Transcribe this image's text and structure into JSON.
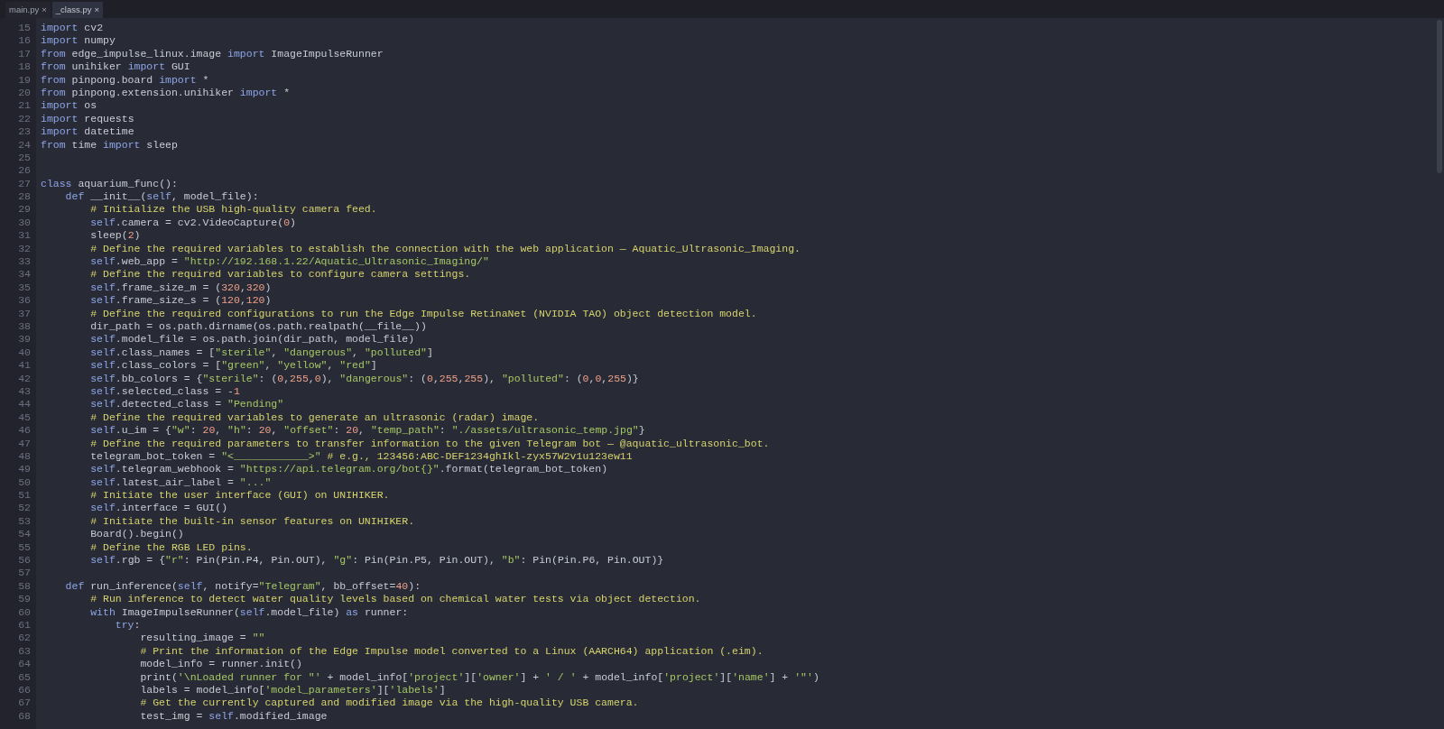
{
  "tabs": [
    {
      "label": "main.py",
      "close": "×",
      "selected": false
    },
    {
      "label": "_class.py",
      "close": "×",
      "selected": true
    }
  ],
  "editor": {
    "lines": [
      {
        "number": "15",
        "tokens": [
          {
            "kind": "kw",
            "text": "import"
          },
          {
            "kind": "plain",
            "text": " cv2"
          }
        ]
      },
      {
        "number": "16",
        "tokens": [
          {
            "kind": "kw",
            "text": "import"
          },
          {
            "kind": "plain",
            "text": " numpy"
          }
        ]
      },
      {
        "number": "17",
        "tokens": [
          {
            "kind": "kw",
            "text": "from"
          },
          {
            "kind": "plain",
            "text": " edge_impulse_linux.image "
          },
          {
            "kind": "kw",
            "text": "import"
          },
          {
            "kind": "plain",
            "text": " ImageImpulseRunner"
          }
        ]
      },
      {
        "number": "18",
        "tokens": [
          {
            "kind": "kw",
            "text": "from"
          },
          {
            "kind": "plain",
            "text": " unihiker "
          },
          {
            "kind": "kw",
            "text": "import"
          },
          {
            "kind": "plain",
            "text": " GUI"
          }
        ]
      },
      {
        "number": "19",
        "tokens": [
          {
            "kind": "kw",
            "text": "from"
          },
          {
            "kind": "plain",
            "text": " pinpong.board "
          },
          {
            "kind": "kw",
            "text": "import"
          },
          {
            "kind": "plain",
            "text": " *"
          }
        ]
      },
      {
        "number": "20",
        "tokens": [
          {
            "kind": "kw",
            "text": "from"
          },
          {
            "kind": "plain",
            "text": " pinpong.extension.unihiker "
          },
          {
            "kind": "kw",
            "text": "import"
          },
          {
            "kind": "plain",
            "text": " *"
          }
        ]
      },
      {
        "number": "21",
        "tokens": [
          {
            "kind": "kw",
            "text": "import"
          },
          {
            "kind": "plain",
            "text": " os"
          }
        ]
      },
      {
        "number": "22",
        "tokens": [
          {
            "kind": "kw",
            "text": "import"
          },
          {
            "kind": "plain",
            "text": " requests"
          }
        ]
      },
      {
        "number": "23",
        "tokens": [
          {
            "kind": "kw",
            "text": "import"
          },
          {
            "kind": "plain",
            "text": " datetime"
          }
        ]
      },
      {
        "number": "24",
        "tokens": [
          {
            "kind": "kw",
            "text": "from"
          },
          {
            "kind": "plain",
            "text": " time "
          },
          {
            "kind": "kw",
            "text": "import"
          },
          {
            "kind": "plain",
            "text": " sleep"
          }
        ]
      },
      {
        "number": "25"
      },
      {
        "number": "26"
      },
      {
        "number": "27",
        "tokens": [
          {
            "kind": "kw",
            "text": "class"
          },
          {
            "kind": "plain",
            "text": " aquarium_func():"
          }
        ]
      },
      {
        "number": "28",
        "tokens": [
          {
            "kind": "kw",
            "text": "    def"
          },
          {
            "kind": "plain",
            "text": " __init__("
          },
          {
            "kind": "kw",
            "text": "self"
          },
          {
            "kind": "plain",
            "text": ", model_file):"
          }
        ]
      },
      {
        "number": "29",
        "tokens": [
          {
            "kind": "com",
            "text": "        # Initialize the USB high-quality camera feed."
          }
        ]
      },
      {
        "number": "30",
        "tokens": [
          {
            "kind": "kw",
            "text": "        self"
          },
          {
            "kind": "plain",
            "text": ".camera = cv2.VideoCapture("
          },
          {
            "kind": "num",
            "text": "0"
          },
          {
            "kind": "plain",
            "text": ")"
          }
        ]
      },
      {
        "number": "31",
        "tokens": [
          {
            "kind": "plain",
            "text": "        sleep("
          },
          {
            "kind": "num",
            "text": "2"
          },
          {
            "kind": "plain",
            "text": ")"
          }
        ]
      },
      {
        "number": "32",
        "tokens": [
          {
            "kind": "com",
            "text": "        # Define the required variables to establish the connection with the web application — Aquatic_Ultrasonic_Imaging."
          }
        ]
      },
      {
        "number": "33",
        "tokens": [
          {
            "kind": "kw",
            "text": "        self"
          },
          {
            "kind": "plain",
            "text": ".web_app = "
          },
          {
            "kind": "str",
            "text": "\"http://192.168.1.22/Aquatic_Ultrasonic_Imaging/\""
          }
        ]
      },
      {
        "number": "34",
        "tokens": [
          {
            "kind": "com",
            "text": "        # Define the required variables to configure camera settings."
          }
        ]
      },
      {
        "number": "35",
        "tokens": [
          {
            "kind": "kw",
            "text": "        self"
          },
          {
            "kind": "plain",
            "text": ".frame_size_m = ("
          },
          {
            "kind": "num",
            "text": "320"
          },
          {
            "kind": "plain",
            "text": ","
          },
          {
            "kind": "num",
            "text": "320"
          },
          {
            "kind": "plain",
            "text": ")"
          }
        ]
      },
      {
        "number": "36",
        "tokens": [
          {
            "kind": "kw",
            "text": "        self"
          },
          {
            "kind": "plain",
            "text": ".frame_size_s = ("
          },
          {
            "kind": "num",
            "text": "120"
          },
          {
            "kind": "plain",
            "text": ","
          },
          {
            "kind": "num",
            "text": "120"
          },
          {
            "kind": "plain",
            "text": ")"
          }
        ]
      },
      {
        "number": "37",
        "tokens": [
          {
            "kind": "com",
            "text": "        # Define the required configurations to run the Edge Impulse RetinaNet (NVIDIA TAO) object detection model."
          }
        ]
      },
      {
        "number": "38",
        "tokens": [
          {
            "kind": "plain",
            "text": "        dir_path = os.path.dirname(os.path.realpath(__file__))"
          }
        ]
      },
      {
        "number": "39",
        "tokens": [
          {
            "kind": "kw",
            "text": "        self"
          },
          {
            "kind": "plain",
            "text": ".model_file = os.path.join(dir_path, model_file)"
          }
        ]
      },
      {
        "number": "40",
        "tokens": [
          {
            "kind": "kw",
            "text": "        self"
          },
          {
            "kind": "plain",
            "text": ".class_names = ["
          },
          {
            "kind": "str",
            "text": "\"sterile\""
          },
          {
            "kind": "plain",
            "text": ", "
          },
          {
            "kind": "str",
            "text": "\"dangerous\""
          },
          {
            "kind": "plain",
            "text": ", "
          },
          {
            "kind": "str",
            "text": "\"polluted\""
          },
          {
            "kind": "plain",
            "text": "]"
          }
        ]
      },
      {
        "number": "41",
        "tokens": [
          {
            "kind": "kw",
            "text": "        self"
          },
          {
            "kind": "plain",
            "text": ".class_colors = ["
          },
          {
            "kind": "str",
            "text": "\"green\""
          },
          {
            "kind": "plain",
            "text": ", "
          },
          {
            "kind": "str",
            "text": "\"yellow\""
          },
          {
            "kind": "plain",
            "text": ", "
          },
          {
            "kind": "str",
            "text": "\"red\""
          },
          {
            "kind": "plain",
            "text": "]"
          }
        ]
      },
      {
        "number": "42",
        "tokens": [
          {
            "kind": "kw",
            "text": "        self"
          },
          {
            "kind": "plain",
            "text": ".bb_colors = {"
          },
          {
            "kind": "str",
            "text": "\"sterile\""
          },
          {
            "kind": "plain",
            "text": ": ("
          },
          {
            "kind": "num",
            "text": "0"
          },
          {
            "kind": "plain",
            "text": ","
          },
          {
            "kind": "num",
            "text": "255"
          },
          {
            "kind": "plain",
            "text": ","
          },
          {
            "kind": "num",
            "text": "0"
          },
          {
            "kind": "plain",
            "text": "), "
          },
          {
            "kind": "str",
            "text": "\"dangerous\""
          },
          {
            "kind": "plain",
            "text": ": ("
          },
          {
            "kind": "num",
            "text": "0"
          },
          {
            "kind": "plain",
            "text": ","
          },
          {
            "kind": "num",
            "text": "255"
          },
          {
            "kind": "plain",
            "text": ","
          },
          {
            "kind": "num",
            "text": "255"
          },
          {
            "kind": "plain",
            "text": "), "
          },
          {
            "kind": "str",
            "text": "\"polluted\""
          },
          {
            "kind": "plain",
            "text": ": ("
          },
          {
            "kind": "num",
            "text": "0"
          },
          {
            "kind": "plain",
            "text": ","
          },
          {
            "kind": "num",
            "text": "0"
          },
          {
            "kind": "plain",
            "text": ","
          },
          {
            "kind": "num",
            "text": "255"
          },
          {
            "kind": "plain",
            "text": ")}"
          }
        ]
      },
      {
        "number": "43",
        "tokens": [
          {
            "kind": "kw",
            "text": "        self"
          },
          {
            "kind": "plain",
            "text": ".selected_class = -"
          },
          {
            "kind": "num",
            "text": "1"
          }
        ]
      },
      {
        "number": "44",
        "tokens": [
          {
            "kind": "kw",
            "text": "        self"
          },
          {
            "kind": "plain",
            "text": ".detected_class = "
          },
          {
            "kind": "str",
            "text": "\"Pending\""
          }
        ]
      },
      {
        "number": "45",
        "tokens": [
          {
            "kind": "com",
            "text": "        # Define the required variables to generate an ultrasonic (radar) image."
          }
        ]
      },
      {
        "number": "46",
        "tokens": [
          {
            "kind": "kw",
            "text": "        self"
          },
          {
            "kind": "plain",
            "text": ".u_im = {"
          },
          {
            "kind": "str",
            "text": "\"w\""
          },
          {
            "kind": "plain",
            "text": ": "
          },
          {
            "kind": "num",
            "text": "20"
          },
          {
            "kind": "plain",
            "text": ", "
          },
          {
            "kind": "str",
            "text": "\"h\""
          },
          {
            "kind": "plain",
            "text": ": "
          },
          {
            "kind": "num",
            "text": "20"
          },
          {
            "kind": "plain",
            "text": ", "
          },
          {
            "kind": "str",
            "text": "\"offset\""
          },
          {
            "kind": "plain",
            "text": ": "
          },
          {
            "kind": "num",
            "text": "20"
          },
          {
            "kind": "plain",
            "text": ", "
          },
          {
            "kind": "str",
            "text": "\"temp_path\""
          },
          {
            "kind": "plain",
            "text": ": "
          },
          {
            "kind": "str",
            "text": "\"./assets/ultrasonic_temp.jpg\""
          },
          {
            "kind": "plain",
            "text": "}"
          }
        ]
      },
      {
        "number": "47",
        "tokens": [
          {
            "kind": "com",
            "text": "        # Define the required parameters to transfer information to the given Telegram bot — @aquatic_ultrasonic_bot."
          }
        ]
      },
      {
        "number": "48",
        "tokens": [
          {
            "kind": "plain",
            "text": "        telegram_bot_token = "
          },
          {
            "kind": "str",
            "text": "\"<____________>\""
          },
          {
            "kind": "com",
            "text": " # e.g., 123456:ABC-DEF1234ghIkl-zyx57W2v1u123ew11"
          }
        ]
      },
      {
        "number": "49",
        "tokens": [
          {
            "kind": "kw",
            "text": "        self"
          },
          {
            "kind": "plain",
            "text": ".telegram_webhook = "
          },
          {
            "kind": "str",
            "text": "\"https://api.telegram.org/bot{}\""
          },
          {
            "kind": "plain",
            "text": ".format(telegram_bot_token)"
          }
        ]
      },
      {
        "number": "50",
        "tokens": [
          {
            "kind": "kw",
            "text": "        self"
          },
          {
            "kind": "plain",
            "text": ".latest_air_label = "
          },
          {
            "kind": "str",
            "text": "\"...\""
          }
        ]
      },
      {
        "number": "51",
        "tokens": [
          {
            "kind": "com",
            "text": "        # Initiate the user interface (GUI) on UNIHIKER."
          }
        ]
      },
      {
        "number": "52",
        "tokens": [
          {
            "kind": "kw",
            "text": "        self"
          },
          {
            "kind": "plain",
            "text": ".interface = GUI()"
          }
        ]
      },
      {
        "number": "53",
        "tokens": [
          {
            "kind": "com",
            "text": "        # Initiate the built-in sensor features on UNIHIKER."
          }
        ]
      },
      {
        "number": "54",
        "tokens": [
          {
            "kind": "plain",
            "text": "        Board().begin()"
          }
        ]
      },
      {
        "number": "55",
        "tokens": [
          {
            "kind": "com",
            "text": "        # Define the RGB LED pins."
          }
        ]
      },
      {
        "number": "56",
        "tokens": [
          {
            "kind": "kw",
            "text": "        self"
          },
          {
            "kind": "plain",
            "text": ".rgb = {"
          },
          {
            "kind": "str",
            "text": "\"r\""
          },
          {
            "kind": "plain",
            "text": ": Pin(Pin.P4, Pin.OUT), "
          },
          {
            "kind": "str",
            "text": "\"g\""
          },
          {
            "kind": "plain",
            "text": ": Pin(Pin.P5, Pin.OUT), "
          },
          {
            "kind": "str",
            "text": "\"b\""
          },
          {
            "kind": "plain",
            "text": ": Pin(Pin.P6, Pin.OUT)}"
          }
        ]
      },
      {
        "number": "57"
      },
      {
        "number": "58",
        "tokens": [
          {
            "kind": "kw",
            "text": "    def"
          },
          {
            "kind": "plain",
            "text": " run_inference("
          },
          {
            "kind": "kw",
            "text": "self"
          },
          {
            "kind": "plain",
            "text": ", notify="
          },
          {
            "kind": "str",
            "text": "\"Telegram\""
          },
          {
            "kind": "plain",
            "text": ", bb_offset="
          },
          {
            "kind": "num",
            "text": "40"
          },
          {
            "kind": "plain",
            "text": "):"
          }
        ]
      },
      {
        "number": "59",
        "tokens": [
          {
            "kind": "com",
            "text": "        # Run inference to detect water quality levels based on chemical water tests via object detection."
          }
        ]
      },
      {
        "number": "60",
        "tokens": [
          {
            "kind": "kw",
            "text": "        with"
          },
          {
            "kind": "plain",
            "text": " ImageImpulseRunner("
          },
          {
            "kind": "kw",
            "text": "self"
          },
          {
            "kind": "plain",
            "text": ".model_file) "
          },
          {
            "kind": "kw",
            "text": "as"
          },
          {
            "kind": "plain",
            "text": " runner:"
          }
        ]
      },
      {
        "number": "61",
        "tokens": [
          {
            "kind": "kw",
            "text": "            try"
          },
          {
            "kind": "plain",
            "text": ":"
          }
        ]
      },
      {
        "number": "62",
        "tokens": [
          {
            "kind": "plain",
            "text": "                resulting_image = "
          },
          {
            "kind": "str",
            "text": "\"\""
          }
        ]
      },
      {
        "number": "63",
        "tokens": [
          {
            "kind": "com",
            "text": "                # Print the information of the Edge Impulse model converted to a Linux (AARCH64) application (.eim)."
          }
        ]
      },
      {
        "number": "64",
        "tokens": [
          {
            "kind": "plain",
            "text": "                model_info = runner.init()"
          }
        ]
      },
      {
        "number": "65",
        "tokens": [
          {
            "kind": "plain",
            "text": "                print("
          },
          {
            "kind": "str",
            "text": "'\\nLoaded runner for \"'"
          },
          {
            "kind": "plain",
            "text": " + model_info["
          },
          {
            "kind": "str",
            "text": "'project'"
          },
          {
            "kind": "plain",
            "text": "]["
          },
          {
            "kind": "str",
            "text": "'owner'"
          },
          {
            "kind": "plain",
            "text": "] + "
          },
          {
            "kind": "str",
            "text": "' / '"
          },
          {
            "kind": "plain",
            "text": " + model_info["
          },
          {
            "kind": "str",
            "text": "'project'"
          },
          {
            "kind": "plain",
            "text": "]["
          },
          {
            "kind": "str",
            "text": "'name'"
          },
          {
            "kind": "plain",
            "text": "] + "
          },
          {
            "kind": "str",
            "text": "'\"'"
          },
          {
            "kind": "plain",
            "text": ")"
          }
        ]
      },
      {
        "number": "66",
        "tokens": [
          {
            "kind": "plain",
            "text": "                labels = model_info["
          },
          {
            "kind": "str",
            "text": "'model_parameters'"
          },
          {
            "kind": "plain",
            "text": "]["
          },
          {
            "kind": "str",
            "text": "'labels'"
          },
          {
            "kind": "plain",
            "text": "]"
          }
        ]
      },
      {
        "number": "67",
        "tokens": [
          {
            "kind": "com",
            "text": "                # Get the currently captured and modified image via the high-quality USB camera."
          }
        ]
      },
      {
        "number": "68",
        "tokens": [
          {
            "kind": "plain",
            "text": "                test_img = "
          },
          {
            "kind": "kw",
            "text": "self"
          },
          {
            "kind": "plain",
            "text": ".modified_image"
          }
        ]
      }
    ]
  }
}
